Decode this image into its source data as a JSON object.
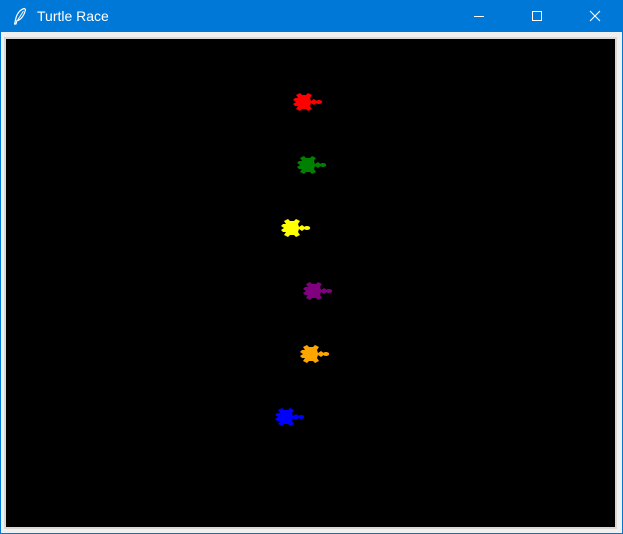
{
  "window": {
    "title": "Turtle Race",
    "app_icon": "feather-icon",
    "controls": [
      "minimize-icon",
      "maximize-icon",
      "close-icon"
    ]
  },
  "canvas": {
    "background": "#000000",
    "turtles": [
      {
        "color": "red",
        "hex": "#ff0000"
      },
      {
        "color": "green",
        "hex": "#008000"
      },
      {
        "color": "yellow",
        "hex": "#ffff00"
      },
      {
        "color": "purple",
        "hex": "#800080"
      },
      {
        "color": "orange",
        "hex": "#ffa500"
      },
      {
        "color": "blue",
        "hex": "#0000ff"
      }
    ]
  }
}
